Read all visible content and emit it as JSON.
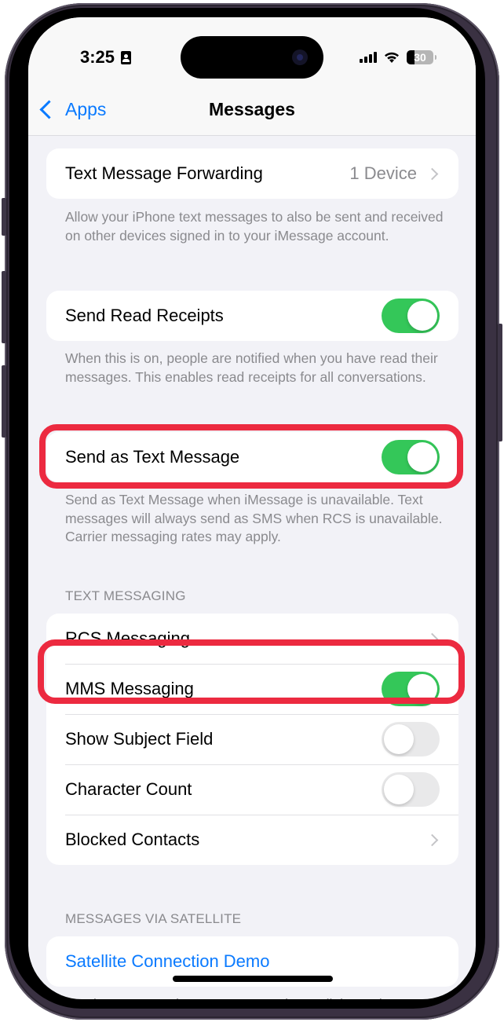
{
  "status_bar": {
    "time": "3:25",
    "battery_percent": 30,
    "battery_label": "30",
    "icons": [
      "focus-id-icon",
      "signal-icon",
      "wifi-icon",
      "battery-icon"
    ]
  },
  "nav": {
    "back_label": "Apps",
    "title": "Messages"
  },
  "groups": {
    "forwarding": {
      "label": "Text Message Forwarding",
      "value": "1 Device",
      "footer": "Allow your iPhone text messages to also be sent and received on other devices signed in to your iMessage account."
    },
    "read_receipts": {
      "label": "Send Read Receipts",
      "on": true,
      "footer": "When this is on, people are notified when you have read their messages. This enables read receipts for all conversations."
    },
    "send_as_text": {
      "label": "Send as Text Message",
      "on": true,
      "footer": "Send as Text Message when iMessage is unavailable. Text messages will always send as SMS when RCS is unavailable. Carrier messaging rates may apply."
    },
    "text_messaging": {
      "header": "TEXT MESSAGING",
      "rows": [
        {
          "label": "RCS Messaging",
          "type": "chevron"
        },
        {
          "label": "MMS Messaging",
          "type": "toggle",
          "on": true
        },
        {
          "label": "Show Subject Field",
          "type": "toggle",
          "on": false
        },
        {
          "label": "Character Count",
          "type": "toggle",
          "on": false
        },
        {
          "label": "Blocked Contacts",
          "type": "chevron"
        }
      ]
    },
    "satellite": {
      "header": "MESSAGES VIA SATELLITE",
      "link_label": "Satellite Connection Demo",
      "footer": "Use iMessage and text messages when cellular and"
    }
  },
  "colors": {
    "accent": "#0a7aff",
    "toggle_on": "#34c759",
    "highlight": "#ec2a40",
    "background": "#f2f2f7"
  }
}
